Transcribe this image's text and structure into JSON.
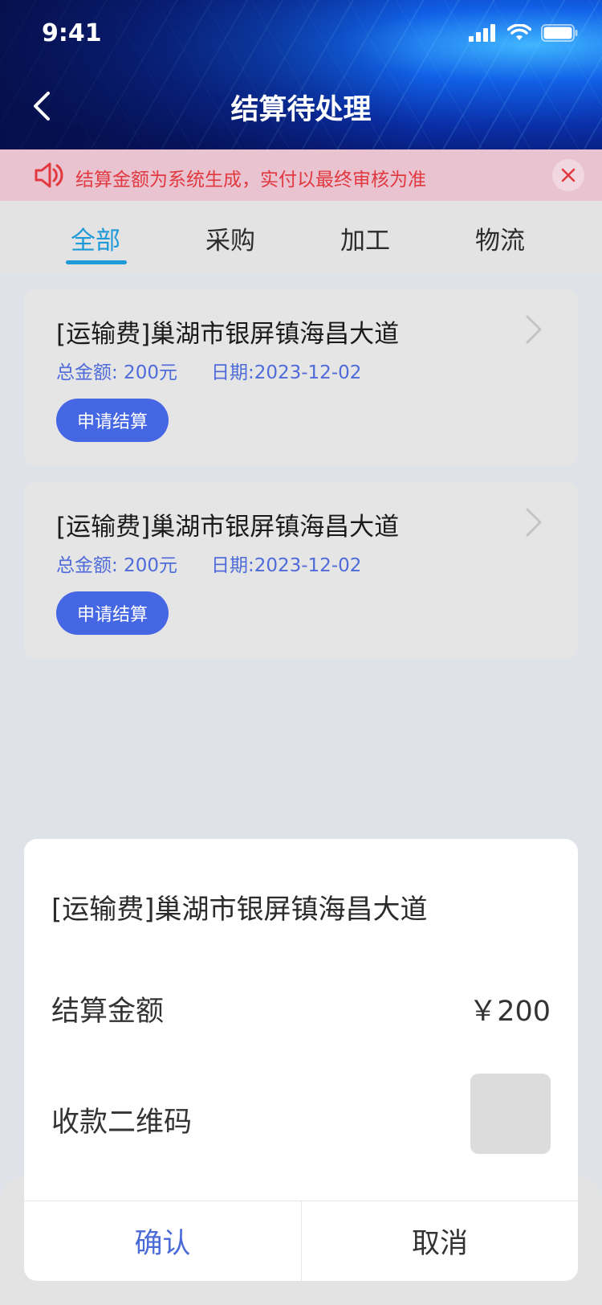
{
  "status_bar": {
    "time": "9:41"
  },
  "header": {
    "title": "结算待处理"
  },
  "notice": {
    "text": "结算金额为系统生成，实付以最终审核为准"
  },
  "tabs": [
    {
      "label": "全部",
      "active": true
    },
    {
      "label": "采购",
      "active": false
    },
    {
      "label": "加工",
      "active": false
    },
    {
      "label": "物流",
      "active": false
    }
  ],
  "cards": [
    {
      "title": "[运输费]巢湖市银屏镇海昌大道",
      "amount": "总金额: 200元",
      "date": "日期:2023-12-02",
      "button": "申请结算"
    },
    {
      "title": "[运输费]巢湖市银屏镇海昌大道",
      "amount": "总金额: 200元",
      "date": "日期:2023-12-02",
      "button": "申请结算"
    }
  ],
  "modal": {
    "title": "[运输费]巢湖市银屏镇海昌大道",
    "amount_label": "结算金额",
    "amount_value": "￥200",
    "qr_label": "收款二维码",
    "confirm": "确认",
    "cancel": "取消"
  },
  "colors": {
    "accent": "#4667e3",
    "tab_active": "#1f9ad8",
    "notice_text": "#e2383f"
  }
}
